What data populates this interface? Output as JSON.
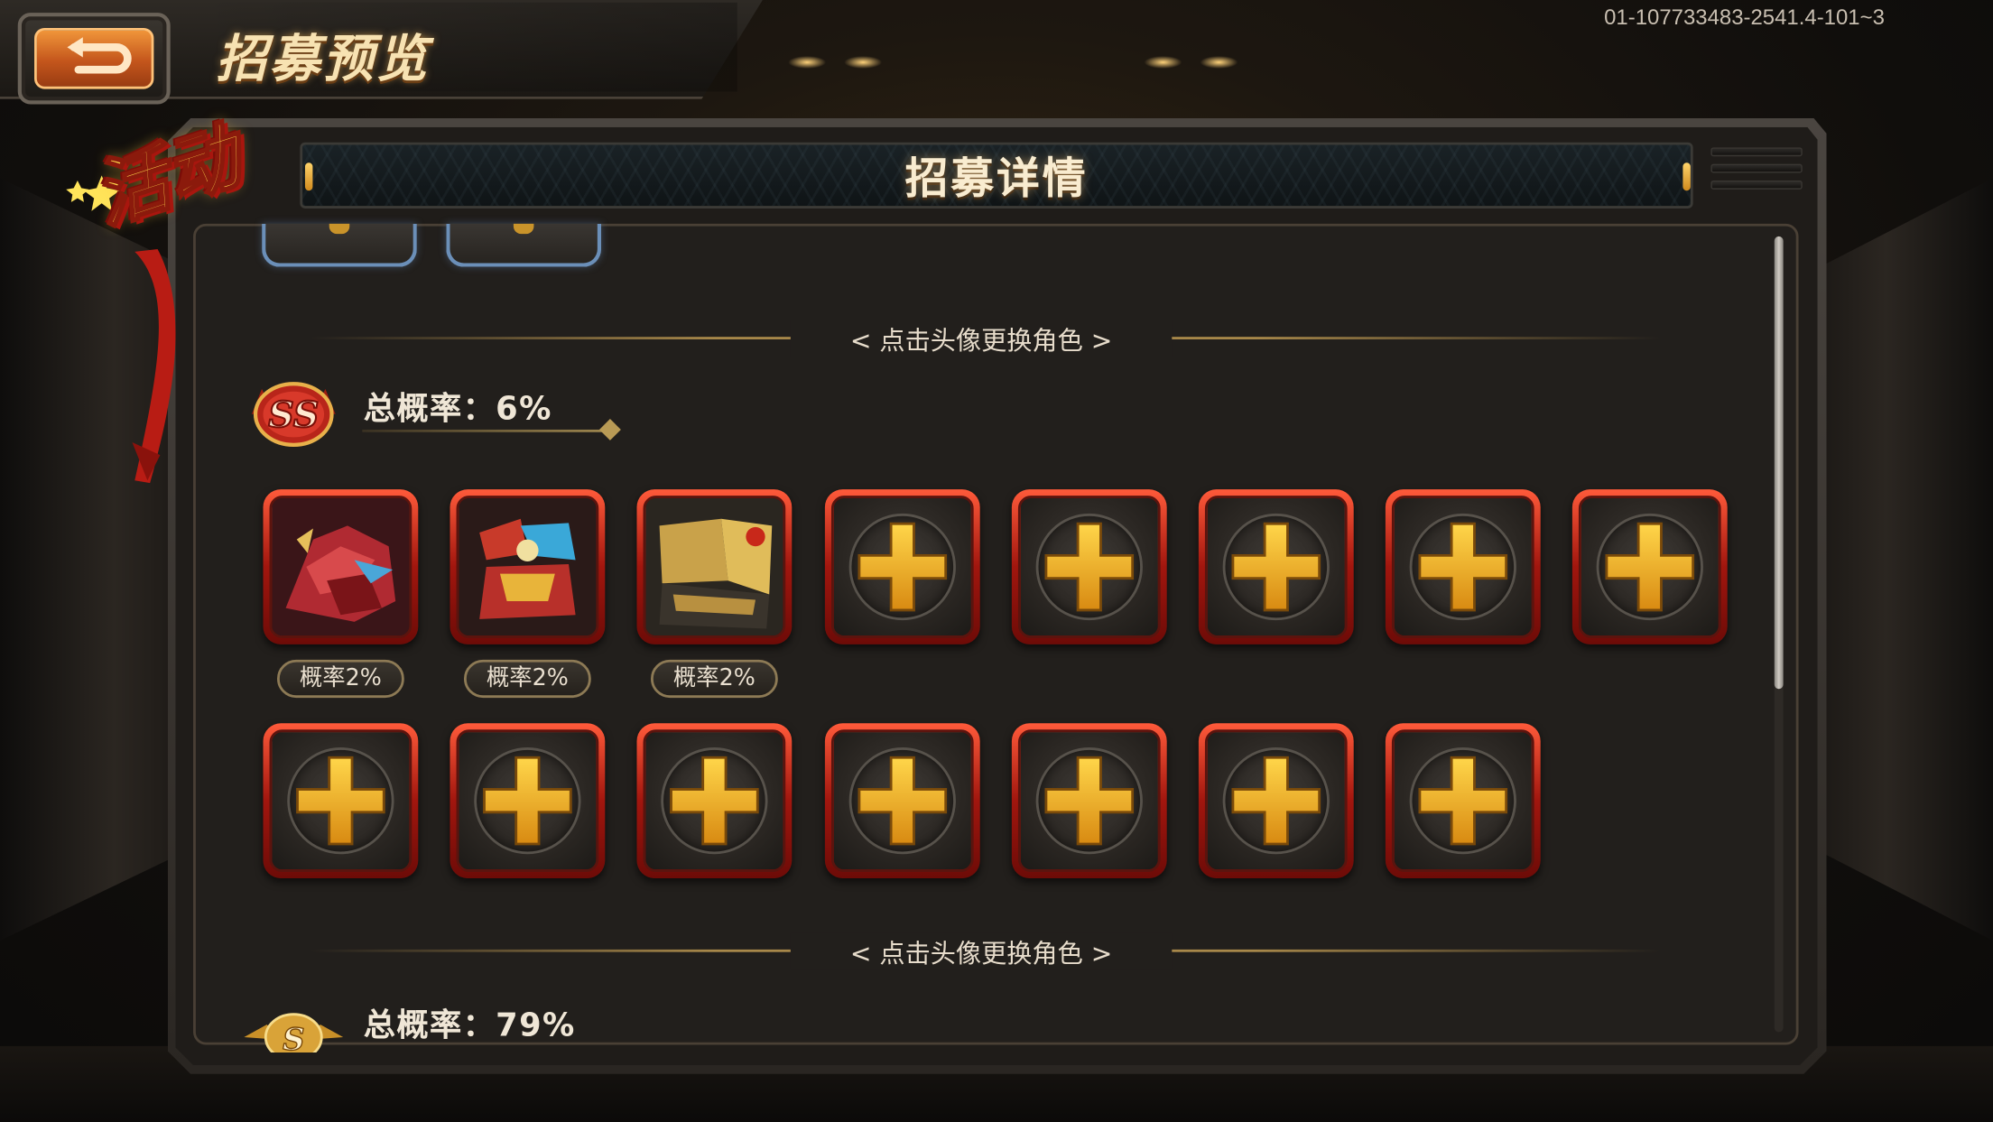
{
  "header": {
    "page_title": "招募预览",
    "build_id": "01-107733483-2541.4-101~3",
    "back_icon": "back-arrow-icon"
  },
  "event_badge": {
    "label": "活动"
  },
  "panel": {
    "title": "招募详情",
    "menu_icon": "menu-lines-icon"
  },
  "hint": {
    "text": "< 点击头像更换角色 >"
  },
  "tiers": [
    {
      "tier": "SS",
      "total_rate": "总概率：6%",
      "filled_slots": [
        {
          "probability_label": "概率2%"
        },
        {
          "probability_label": "概率2%"
        },
        {
          "probability_label": "概率2%"
        }
      ],
      "empty_slot_icon": "plus-icon",
      "empty_slots": 12
    },
    {
      "tier": "S",
      "total_rate": "总概率：79%"
    }
  ],
  "colors": {
    "slot_border": "#c8281a",
    "plus_gold": "#f2b030",
    "title_cream": "#f7e2b2",
    "prev_tier_border": "#6b8fb8"
  }
}
